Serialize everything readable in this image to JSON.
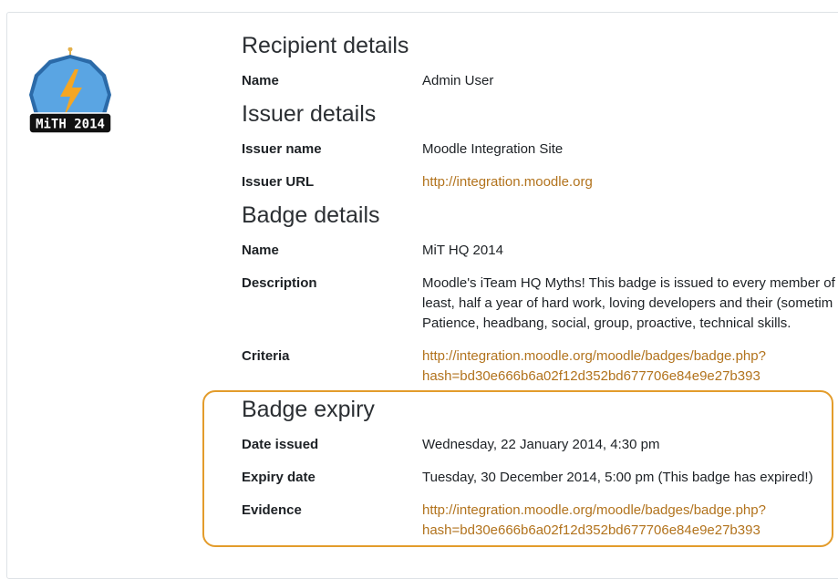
{
  "badge_image": {
    "label": "MiTH 2014"
  },
  "recipient": {
    "heading": "Recipient details",
    "name_label": "Name",
    "name_value": "Admin User"
  },
  "issuer": {
    "heading": "Issuer details",
    "name_label": "Issuer name",
    "name_value": "Moodle Integration Site",
    "url_label": "Issuer URL",
    "url_value": "http://integration.moodle.org"
  },
  "badge": {
    "heading": "Badge details",
    "name_label": "Name",
    "name_value": "MiT HQ 2014",
    "description_label": "Description",
    "description_lines": [
      "Moodle's iTeam HQ Myths! This badge is issued to every member of",
      "least, half a year of hard work, loving developers and their (sometim",
      "Patience, headbang, social, group, proactive, technical skills."
    ],
    "criteria_label": "Criteria",
    "criteria_lines": [
      "http://integration.moodle.org/moodle/badges/badge.php?",
      "hash=bd30e666b6a02f12d352bd677706e84e9e27b393"
    ]
  },
  "expiry": {
    "heading": "Badge expiry",
    "date_issued_label": "Date issued",
    "date_issued_value": "Wednesday, 22 January 2014, 4:30 pm",
    "expiry_date_label": "Expiry date",
    "expiry_date_value": "Tuesday, 30 December 2014, 5:00 pm (This badge has expired!)",
    "evidence_label": "Evidence",
    "evidence_lines": [
      "http://integration.moodle.org/moodle/badges/badge.php?",
      "hash=bd30e666b6a02f12d352bd677706e84e9e27b393"
    ]
  },
  "colors": {
    "link": "#b2731d",
    "highlight_border": "#e39c2b",
    "badge_fill": "#4a95d6",
    "badge_bolt": "#f5a623"
  }
}
